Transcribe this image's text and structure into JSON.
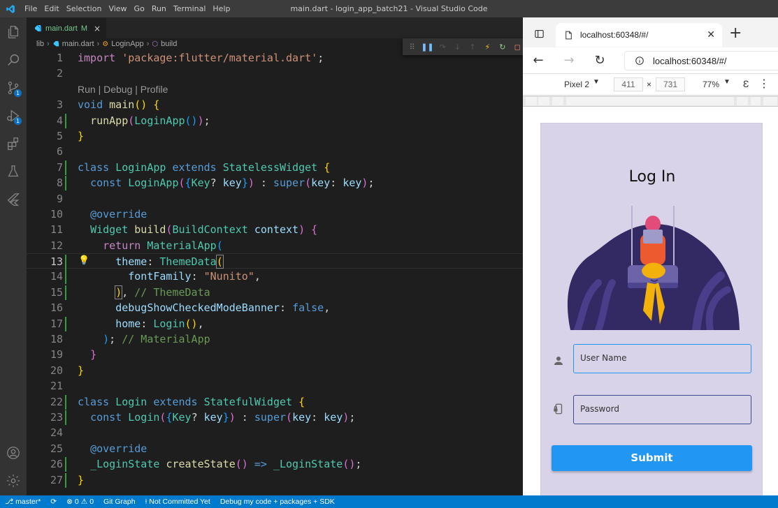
{
  "window": {
    "title": "main.dart - login_app_batch21 - Visual Studio Code",
    "menu": [
      "File",
      "Edit",
      "Selection",
      "View",
      "Go",
      "Run",
      "Terminal",
      "Help"
    ]
  },
  "activity": {
    "source_control_badge": "1",
    "run_debug_badge": "1"
  },
  "editor": {
    "tab": {
      "label": "main.dart",
      "modified": "M",
      "close": "×"
    },
    "breadcrumb": [
      "lib",
      "main.dart",
      "LoginApp",
      "build"
    ],
    "codelens": "Run | Debug | Profile",
    "line_numbers": [
      "1",
      "2",
      "3",
      "4",
      "5",
      "6",
      "7",
      "8",
      "9",
      "10",
      "11",
      "12",
      "13",
      "14",
      "15",
      "16",
      "17",
      "18",
      "19",
      "20",
      "21",
      "22",
      "23",
      "24",
      "25",
      "26",
      "27"
    ],
    "inline_comments": {
      "theme_data": "// ThemeData",
      "material_app": "// MaterialApp"
    }
  },
  "browser": {
    "tab_title": "localhost:60348/#/",
    "url": "localhost:60348/#/",
    "device": "Pixel 2",
    "width": "411",
    "times": "×",
    "height": "731",
    "zoom": "77%",
    "more": "⋮"
  },
  "app": {
    "title": "Log In",
    "username_placeholder": "User Name",
    "password_placeholder": "Password",
    "submit": "Submit",
    "colors": {
      "background": "#d9d3e9",
      "accent": "#2196f3"
    }
  },
  "status": {
    "branch": "master*",
    "errors": "0",
    "warnings": "0",
    "git_graph": "Git Graph",
    "not_committed": "Not Committed Yet",
    "debug_mode": "Debug my code + packages + SDK"
  }
}
